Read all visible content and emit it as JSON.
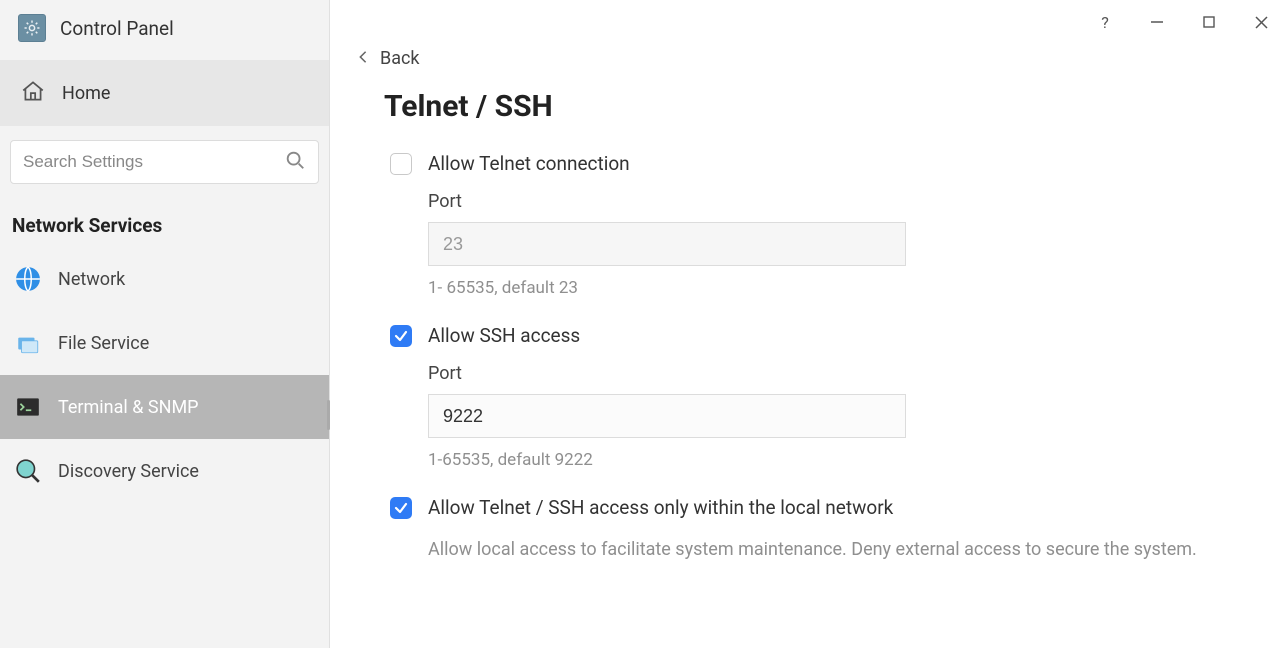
{
  "app_title": "Control Panel",
  "sidebar": {
    "home_label": "Home",
    "search_placeholder": "Search Settings",
    "section_label": "Network Services",
    "items": [
      {
        "label": "Network"
      },
      {
        "label": "File Service"
      },
      {
        "label": "Terminal & SNMP"
      },
      {
        "label": "Discovery Service"
      }
    ]
  },
  "main": {
    "back_label": "Back",
    "heading": "Telnet / SSH",
    "telnet": {
      "label": "Allow Telnet connection",
      "port_label": "Port",
      "port_value": "23",
      "port_hint": "1- 65535, default 23"
    },
    "ssh": {
      "label": "Allow SSH access",
      "port_label": "Port",
      "port_value": "9222",
      "port_hint": "1-65535, default 9222"
    },
    "local_only": {
      "label": "Allow Telnet / SSH access only within the local network",
      "desc": "Allow local access to facilitate system maintenance. Deny external access to secure the system."
    }
  }
}
